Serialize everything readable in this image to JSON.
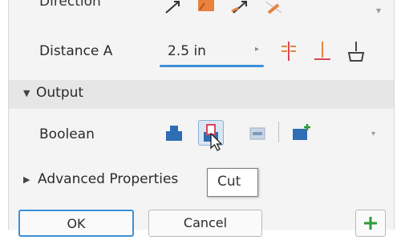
{
  "direction": {
    "label": "Direction"
  },
  "distance": {
    "label": "Distance A",
    "value": "2.5 in"
  },
  "output": {
    "title": "Output"
  },
  "boolean": {
    "label": "Boolean",
    "active": "cut"
  },
  "advanced": {
    "title": "Advanced Properties"
  },
  "tooltip": {
    "text": "Cut"
  },
  "buttons": {
    "ok": "OK",
    "cancel": "Cancel"
  },
  "colors": {
    "accent": "#3c8fd8",
    "bool_blue": "#2f6db5",
    "cut_red": "#d9465a",
    "add_green": "#2e9b3a",
    "dir_orange": "#e8823c"
  },
  "icons": [
    "direction-default-icon",
    "direction-flip-icon",
    "direction-symmetric-icon",
    "direction-asymmetric-icon",
    "distance-measure-icon",
    "distance-extent-icon",
    "distance-to-icon",
    "join-icon",
    "cut-icon",
    "intersect-icon",
    "new-solid-icon",
    "add-icon"
  ]
}
